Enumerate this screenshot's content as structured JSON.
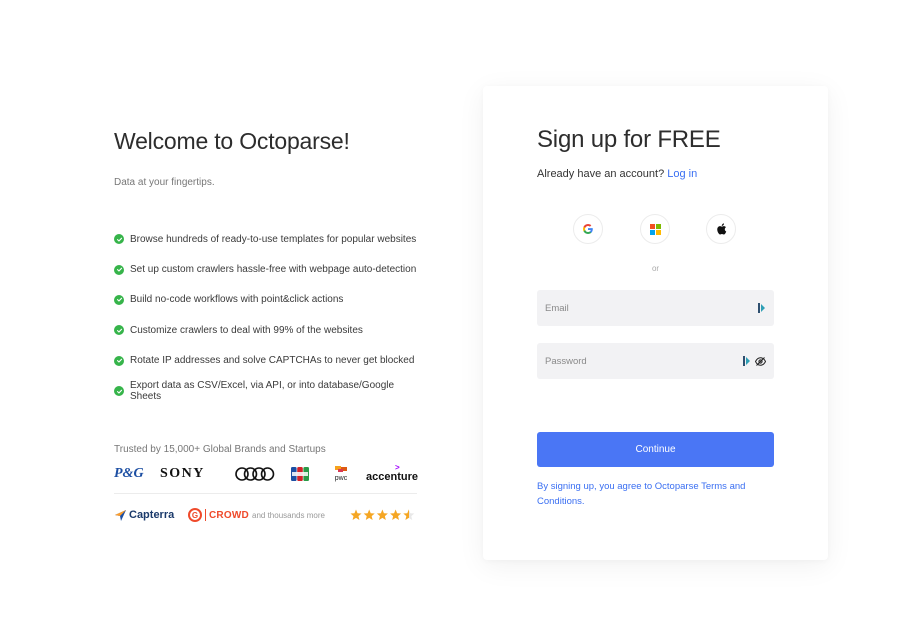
{
  "left": {
    "title": "Welcome to Octoparse!",
    "tagline": "Data at your fingertips.",
    "features": [
      "Browse hundreds of ready-to-use templates for popular websites",
      "Set up custom crawlers hassle-free with webpage auto-detection",
      "Build no-code workflows with point&click actions",
      "Customize crawlers to deal with 99% of the websites",
      "Rotate IP addresses and solve CAPTCHAs to never get blocked",
      "Export data as CSV/Excel, via API, or into database/Google Sheets"
    ],
    "trusted": "Trusted by 15,000+ Global Brands and Startups",
    "brands": {
      "pg": "P&G",
      "sony": "SONY",
      "pwc": "pwc",
      "accenture": "accenture"
    },
    "reviews": {
      "capterra": "Capterra",
      "crowd": "CROWD",
      "more": "and thousands more",
      "rating": 4.5
    }
  },
  "card": {
    "title": "Sign up for FREE",
    "already": "Already have an account?",
    "login": "Log in",
    "or": "or",
    "email_placeholder": "Email",
    "password_placeholder": "Password",
    "continue": "Continue",
    "terms": "By signing up, you agree to Octoparse Terms and Conditions."
  },
  "colors": {
    "accent": "#4a76f5",
    "link": "#3a6ff2",
    "check": "#36b44a",
    "star": "#f5a623"
  }
}
